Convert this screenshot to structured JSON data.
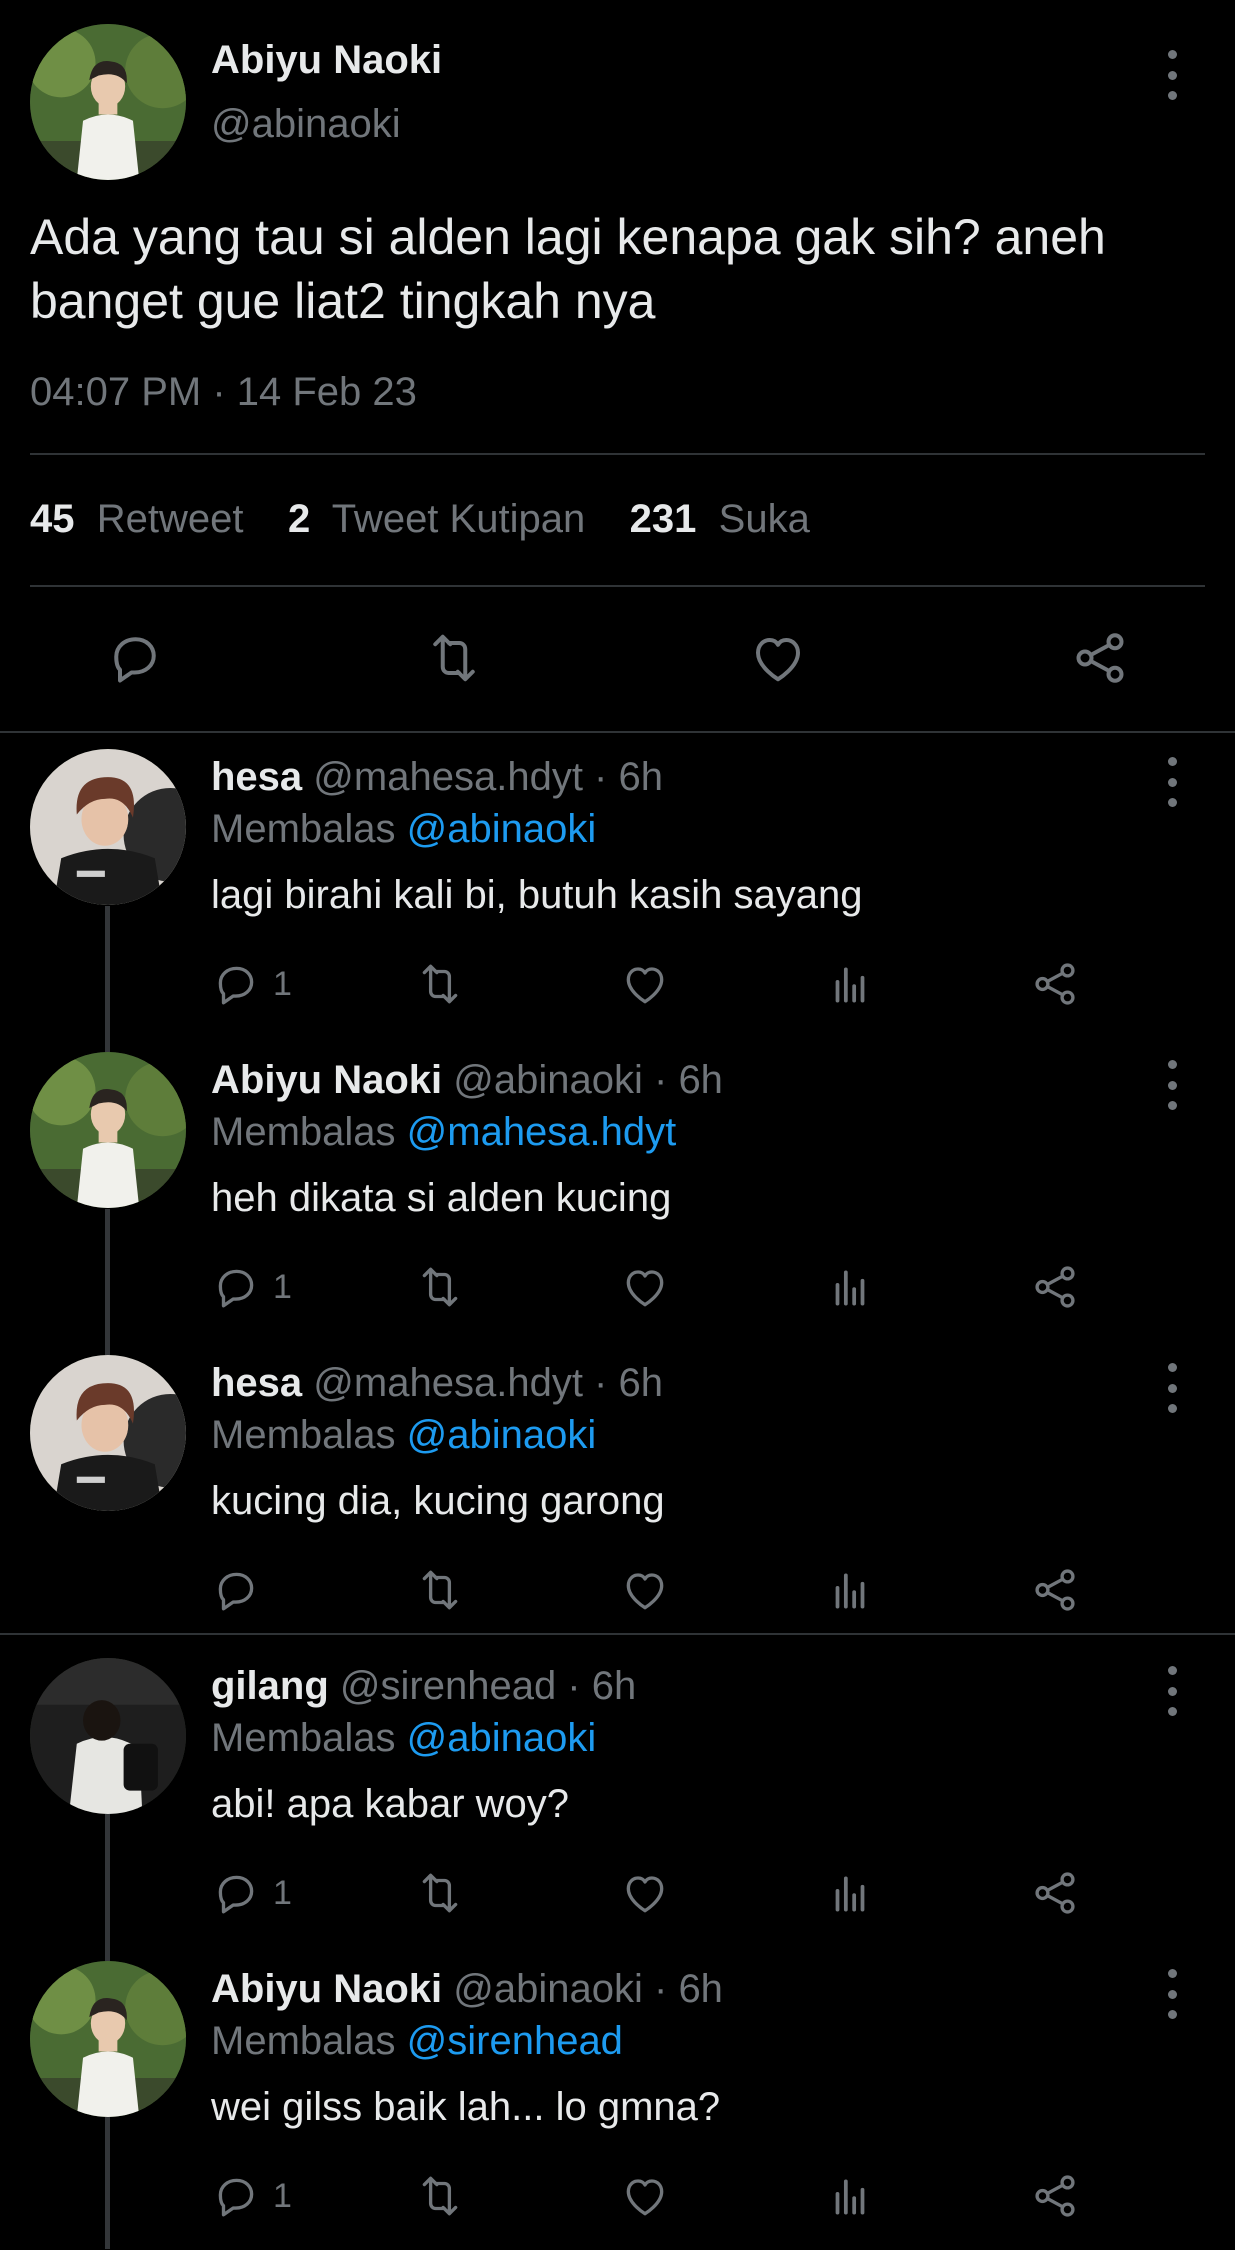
{
  "main_tweet": {
    "author_name": "Abiyu Naoki",
    "handle": "@abinaoki",
    "text": "Ada yang tau si alden lagi kenapa gak sih? aneh banget gue liat2 tingkah nya",
    "timestamp": "04:07 PM · 14 Feb 23",
    "stats": {
      "retweets_count": "45",
      "retweets_label": "Retweet",
      "quotes_count": "2",
      "quotes_label": "Tweet Kutipan",
      "likes_count": "231",
      "likes_label": "Suka"
    },
    "actions": [
      "reply-icon",
      "retweet-icon",
      "like-icon",
      "share-icon"
    ]
  },
  "replies": [
    {
      "name": "hesa",
      "meta": "@mahesa.hdyt · 6h",
      "replying_prefix": "Membalas",
      "replying_to": "@abinaoki",
      "text": "lagi birahi kali bi, butuh kasih sayang",
      "reply_count": "1"
    },
    {
      "name": "Abiyu Naoki",
      "meta": "@abinaoki · 6h",
      "replying_prefix": "Membalas",
      "replying_to": "@mahesa.hdyt",
      "text": "heh dikata si alden kucing",
      "reply_count": "1"
    },
    {
      "name": "hesa",
      "meta": "@mahesa.hdyt · 6h",
      "replying_prefix": "Membalas",
      "replying_to": "@abinaoki",
      "text": "kucing dia, kucing garong",
      "reply_count": ""
    },
    {
      "name": "gilang",
      "meta": "@sirenhead · 6h",
      "replying_prefix": "Membalas",
      "replying_to": "@abinaoki",
      "text": "abi! apa kabar woy?",
      "reply_count": "1"
    },
    {
      "name": "Abiyu Naoki",
      "meta": "@abinaoki · 6h",
      "replying_prefix": "Membalas",
      "replying_to": "@sirenhead",
      "text": "wei gilss baik lah... lo gmna?",
      "reply_count": "1"
    }
  ],
  "colors": {
    "background": "#000000",
    "text": "#e7e9ea",
    "secondary": "#71767b",
    "mention": "#1d9bf0",
    "divider": "#2f3336"
  }
}
